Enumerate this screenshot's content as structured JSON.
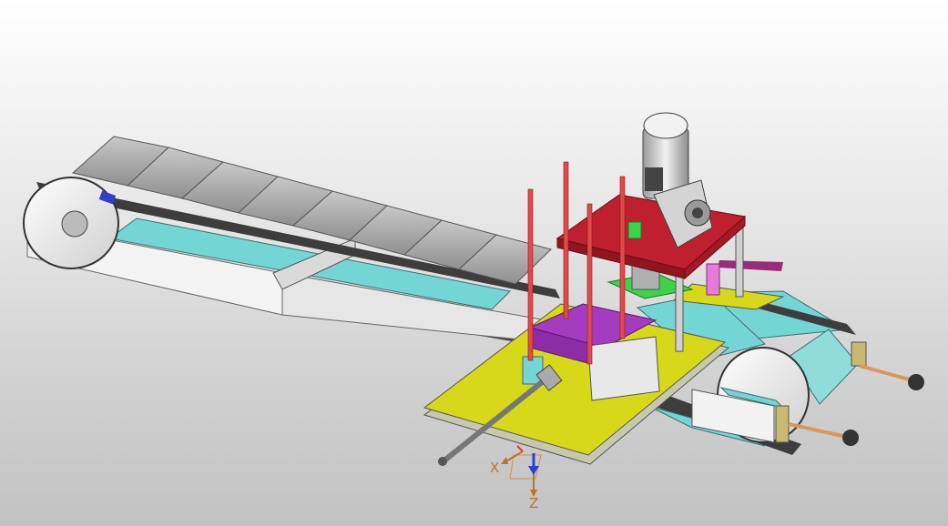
{
  "viewport": {
    "background_top": "#ffffff",
    "background_bottom": "#c2c2c2"
  },
  "model": {
    "parts": [
      "left-conveyor-track",
      "right-conveyor-track",
      "yellow-base-plate",
      "red-top-plate",
      "drive-motor",
      "gearbox",
      "vertical-guide-rods",
      "purple-bristle-block",
      "adjustment-screw-rod"
    ],
    "colors": {
      "frame_cyan": "#74d6d4",
      "slat_gray": "#a9a9a9",
      "plate_yellow": "#d8d81a",
      "top_plate_red": "#bf1f2e",
      "rod_red": "#e04a4a",
      "bristle_purple": "#a43cc0",
      "accent_green": "#3cd24a",
      "accent_pink": "#e67ad4",
      "rod_orange": "#d69a5a"
    }
  },
  "axis": {
    "x_label": "X",
    "z_label": "Z",
    "color": "#b8752a"
  }
}
